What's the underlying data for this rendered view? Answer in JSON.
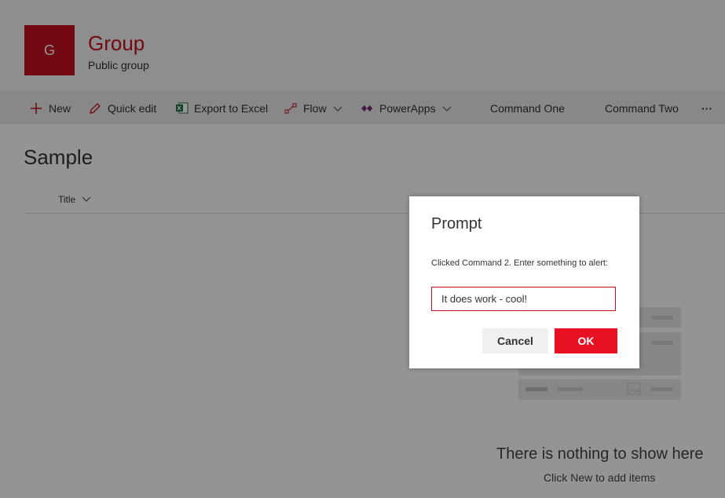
{
  "site": {
    "logo_letter": "G",
    "title": "Group",
    "subtitle": "Public group"
  },
  "commandbar": {
    "new": "New",
    "quick_edit": "Quick edit",
    "export": "Export to Excel",
    "flow": "Flow",
    "powerapps": "PowerApps",
    "command_one": "Command One",
    "command_two": "Command Two",
    "more": "···"
  },
  "list": {
    "title": "Sample",
    "column_title": "Title"
  },
  "empty_state": {
    "title": "There is nothing to show here",
    "subtitle": "Click New to add items"
  },
  "dialog": {
    "title": "Prompt",
    "message": "Clicked Command 2. Enter something to alert:",
    "input_value": "It does work - cool!",
    "cancel_label": "Cancel",
    "ok_label": "OK"
  },
  "colors": {
    "brand": "#c50f1f",
    "ok_button": "#e81123"
  }
}
